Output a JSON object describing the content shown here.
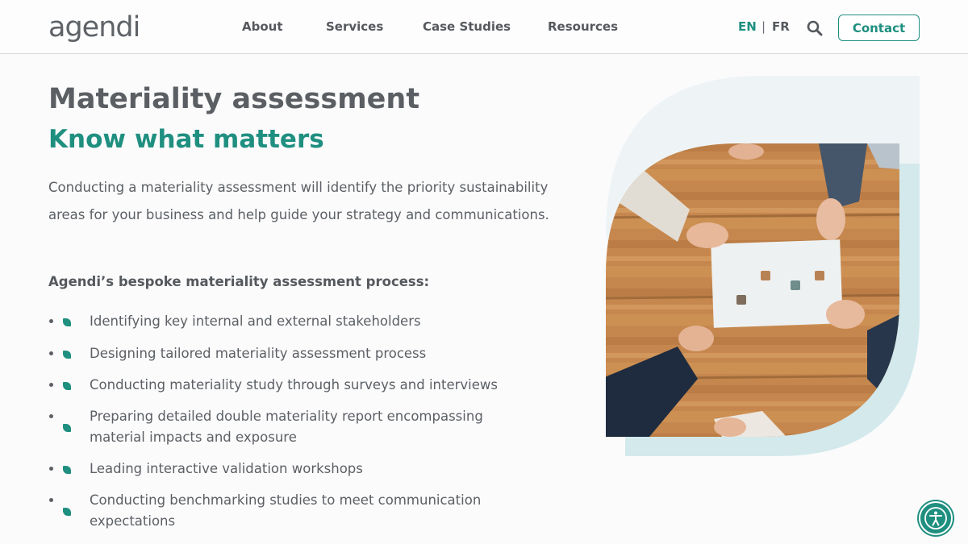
{
  "header": {
    "logo": "agendi",
    "nav": [
      {
        "label": "About"
      },
      {
        "label": "Services"
      },
      {
        "label": "Case Studies"
      },
      {
        "label": "Resources"
      }
    ],
    "lang": {
      "en": "EN",
      "separator": "|",
      "fr": "FR",
      "active": "EN"
    },
    "search_icon": "search-icon",
    "contact_label": "Contact"
  },
  "main": {
    "title": "Materiality assessment",
    "subtitle": "Know what matters",
    "intro": "Conducting a materiality assessment will identify the priority sustainability areas for your business and help guide your strategy and communications.",
    "process_heading": "Agendi’s bespoke materiality assessment process:",
    "bullets": [
      "Identifying key internal and external stakeholders",
      "Designing tailored materiality assessment process",
      "Conducting materiality study through surveys and interviews",
      "Preparing detailed double materiality report encompassing material impacts and exposure",
      "Leading interactive validation workshops",
      "Conducting benchmarking studies to meet communication expectations"
    ]
  },
  "hero": {
    "image_icon": "puzzle-teamwork-photo"
  },
  "accessibility": {
    "icon": "accessibility-icon"
  },
  "colors": {
    "accent": "#1f8f80",
    "text": "#5c6064",
    "heading": "#5b5f63",
    "shape_light": "#eef4f6",
    "shape_teal": "#cfe8ea"
  }
}
